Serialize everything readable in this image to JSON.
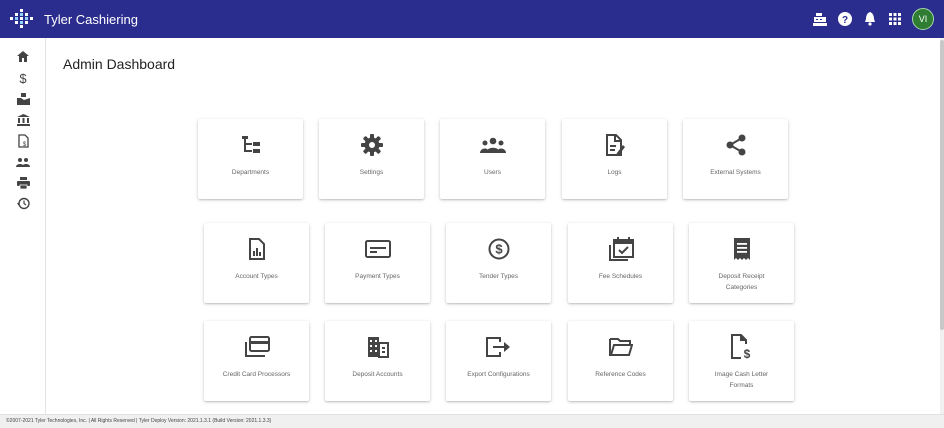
{
  "header": {
    "title": "Tyler Cashiering",
    "avatar_initials": "VI",
    "colors": {
      "bar": "#2b2d8e",
      "avatar": "#2e7d32"
    },
    "icons": [
      "cash-register-icon",
      "help-icon",
      "bell-icon",
      "apps-grid-icon"
    ]
  },
  "sidebar": {
    "items": [
      "home-icon",
      "dollar-icon",
      "money-hand-icon",
      "bank-icon",
      "document-dollar-icon",
      "users-icon",
      "printer-icon",
      "history-icon"
    ]
  },
  "main": {
    "page_title": "Admin Dashboard",
    "cards": [
      {
        "label": "Departments",
        "icon": "departments-icon"
      },
      {
        "label": "Settings",
        "icon": "settings-gear-icon"
      },
      {
        "label": "Users",
        "icon": "users-icon"
      },
      {
        "label": "Logs",
        "icon": "logs-icon"
      },
      {
        "label": "External Systems",
        "icon": "share-icon"
      },
      {
        "label": "Account Types",
        "icon": "account-types-icon"
      },
      {
        "label": "Payment Types",
        "icon": "payment-types-icon"
      },
      {
        "label": "Tender Types",
        "icon": "dollar-circle-icon"
      },
      {
        "label": "Fee Schedules",
        "icon": "calendar-check-icon"
      },
      {
        "label": "Deposit Receipt Categories",
        "icon": "receipt-icon"
      },
      {
        "label": "Credit Card Processors",
        "icon": "credit-cards-icon"
      },
      {
        "label": "Deposit Accounts",
        "icon": "building-icon"
      },
      {
        "label": "Export Configurations",
        "icon": "export-icon"
      },
      {
        "label": "Reference Codes",
        "icon": "folder-open-icon"
      },
      {
        "label": "Image Cash Letter Formats",
        "icon": "file-dollar-icon"
      }
    ]
  },
  "footer": {
    "text": "©2007-2021 Tyler Technologies, Inc. | All Rights Reserved | Tyler Deploy Version: 2021.1.3.1 (Build Version: 2021.1.3.3)"
  }
}
